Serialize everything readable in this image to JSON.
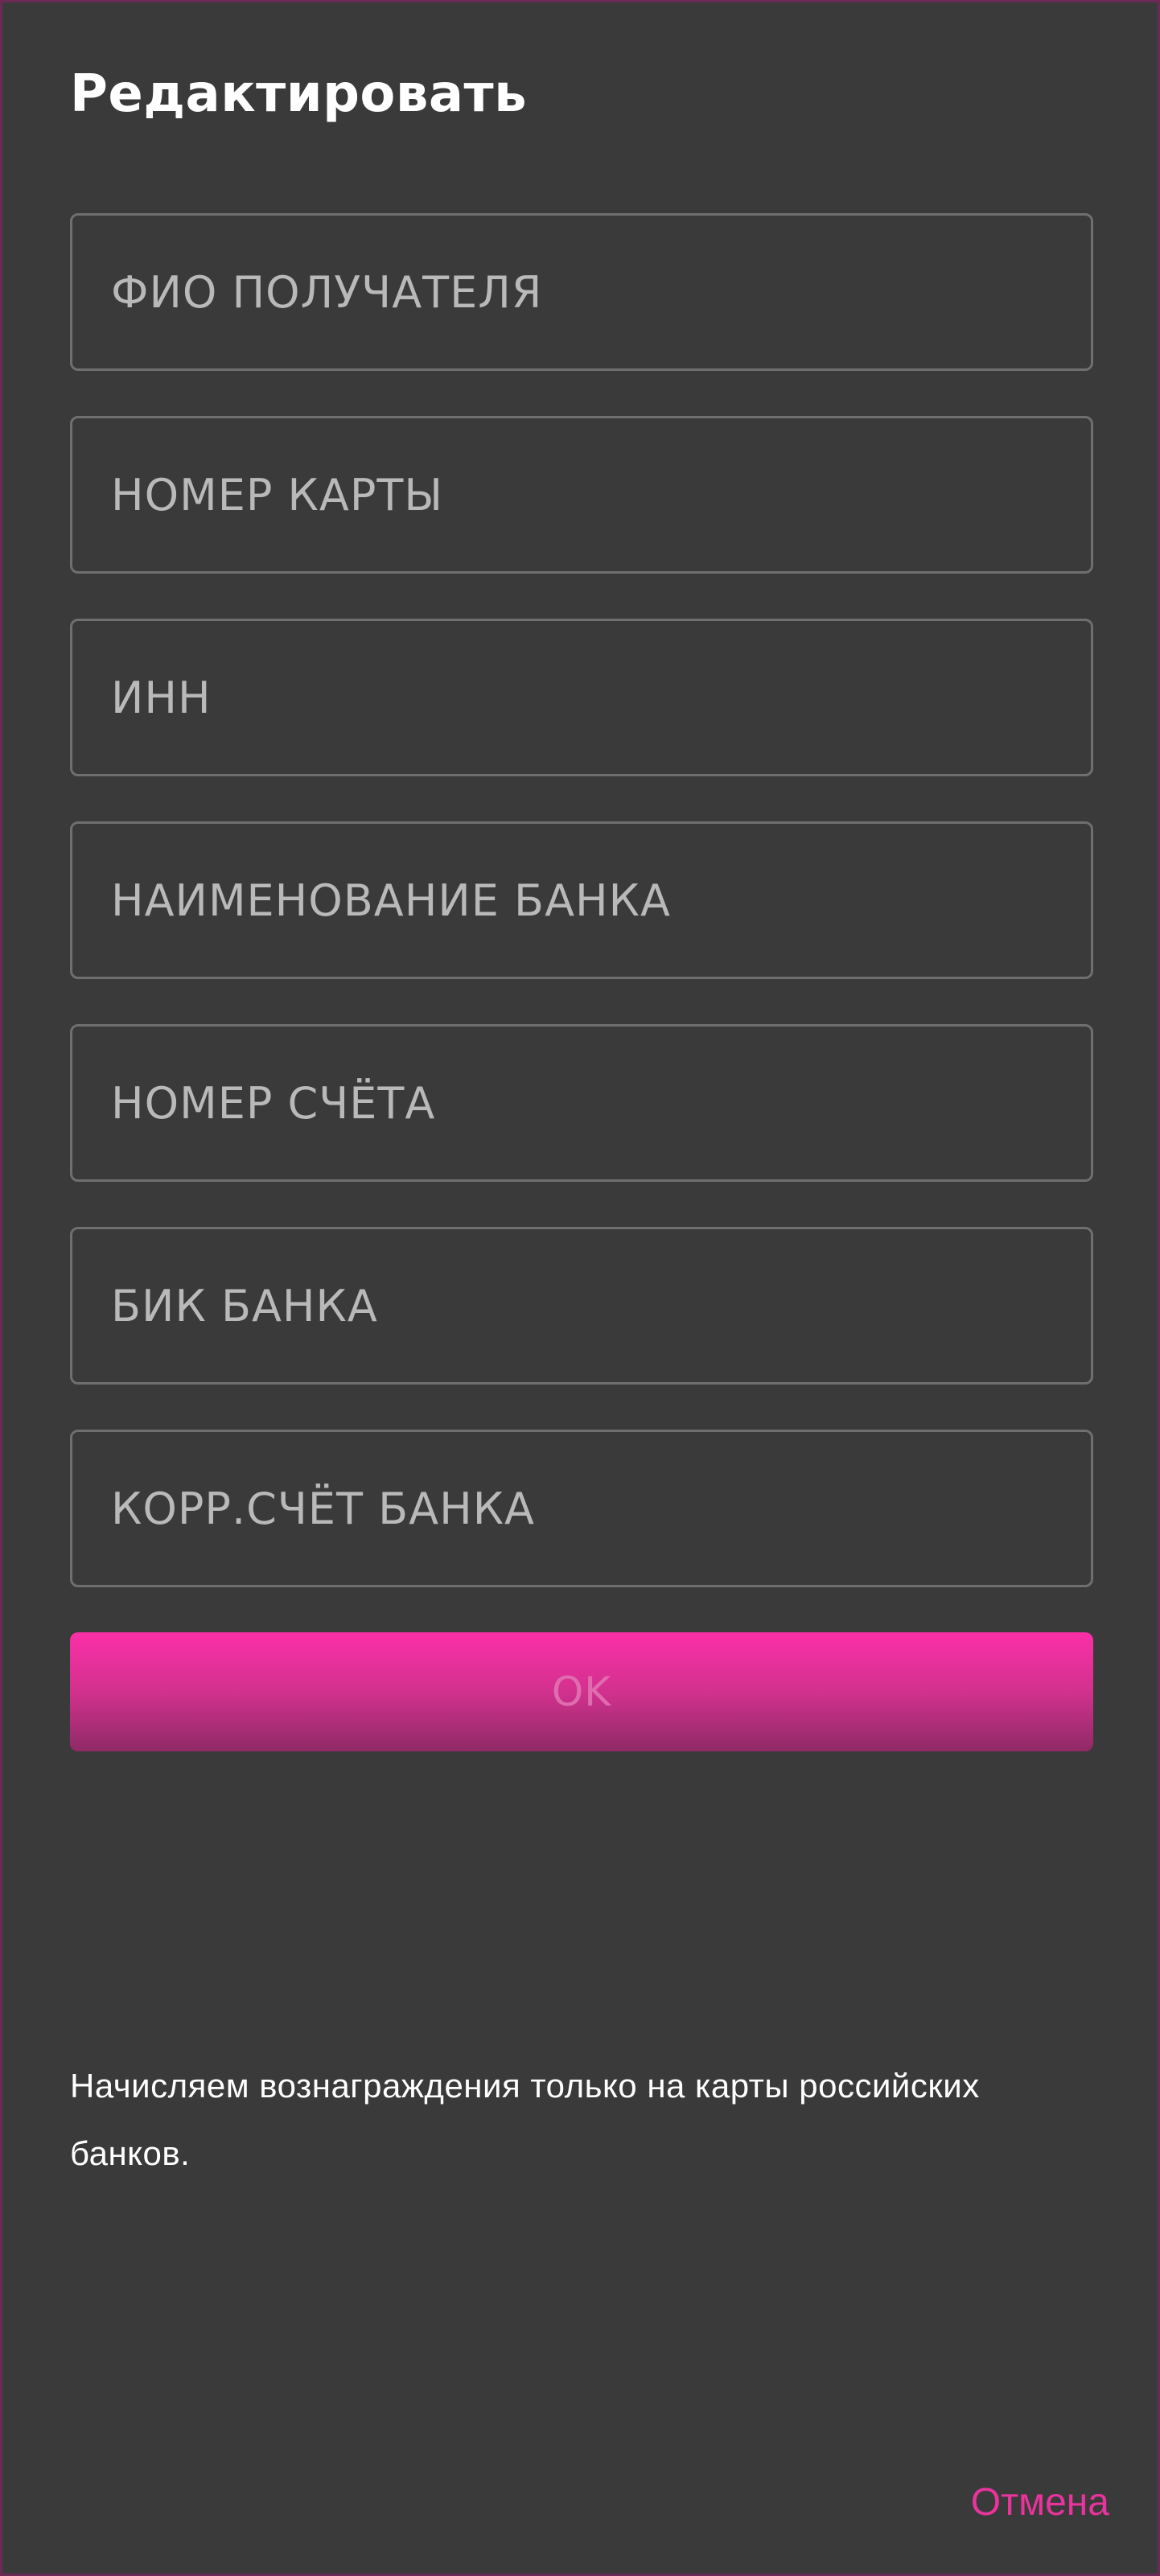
{
  "dialog": {
    "title": "Редактировать"
  },
  "fields": [
    {
      "placeholder": "ФИО ПОЛУЧАТЕЛЯ",
      "value": ""
    },
    {
      "placeholder": "НОМЕР КАРТЫ",
      "value": ""
    },
    {
      "placeholder": "ИНН",
      "value": ""
    },
    {
      "placeholder": "НАИМЕНОВАНИЕ БАНКА",
      "value": ""
    },
    {
      "placeholder": "НОМЕР СЧЁТА",
      "value": ""
    },
    {
      "placeholder": "БИК БАНКА",
      "value": ""
    },
    {
      "placeholder": "КОРР.СЧЁТ БАНКА",
      "value": ""
    }
  ],
  "actions": {
    "ok_label": "OK",
    "cancel_label": "Отмена"
  },
  "notice": "Начисляем вознаграждения только на карты российских банков.",
  "colors": {
    "background": "#3a3a3a",
    "accent": "#e8349c",
    "field_border": "#6f6f6f",
    "button_gradient_top": "#fb2fa8",
    "button_gradient_bottom": "#8f2a66"
  }
}
